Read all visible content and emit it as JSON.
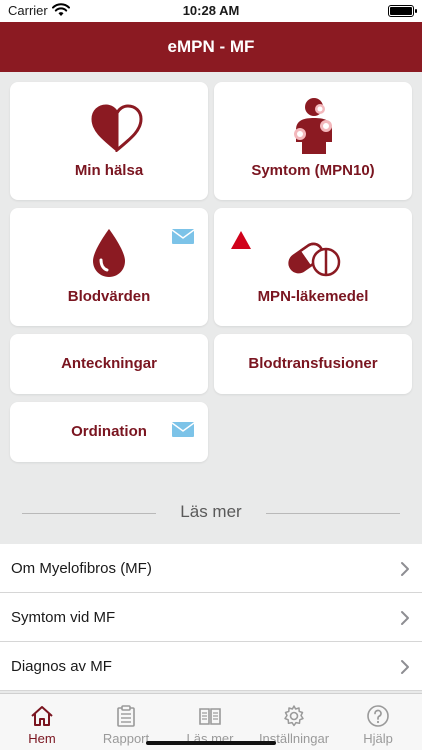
{
  "status_bar": {
    "carrier": "Carrier",
    "time": "10:28 AM"
  },
  "nav": {
    "title": "eMPN - MF"
  },
  "tiles": {
    "min_halsa": "Min hälsa",
    "symtom": "Symtom (MPN10)",
    "blodvarden": "Blodvärden",
    "lakemedel": "MPN-läkemedel",
    "anteckningar": "Anteckningar",
    "blodtransfusioner": "Blodtransfusioner",
    "ordination": "Ordination"
  },
  "las_mer": {
    "heading": "Läs mer",
    "items": [
      {
        "label": "Om Myelofibros (MF)"
      },
      {
        "label": "Symtom vid MF"
      },
      {
        "label": "Diagnos av MF"
      }
    ]
  },
  "tab_bar": {
    "items": [
      {
        "label": "Hem"
      },
      {
        "label": "Rapport"
      },
      {
        "label": "Läs mer"
      },
      {
        "label": "Inställningar"
      },
      {
        "label": "Hjälp"
      }
    ],
    "active": "Hem"
  },
  "colors": {
    "brand": "#8b1a22",
    "tile_text": "#7a1520",
    "mail_badge": "#7cc3e8",
    "warning_triangle": "#d0021b",
    "background": "#e9eaea"
  },
  "icons": {
    "min_halsa": "heart-icon",
    "symtom": "body-pain-icon",
    "blodvarden": "blood-drop-icon",
    "lakemedel": "pills-icon",
    "badge": "mail-icon",
    "alert": "warning-triangle-icon"
  }
}
